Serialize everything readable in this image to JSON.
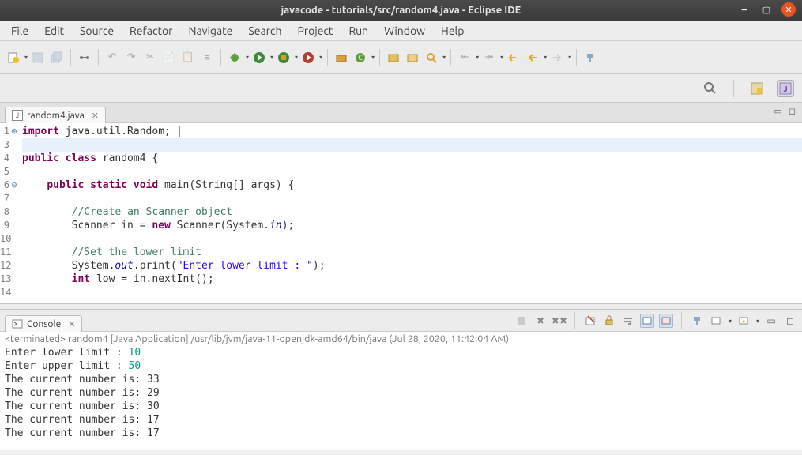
{
  "window": {
    "title": "javacode - tutorials/src/random4.java - Eclipse IDE"
  },
  "menubar": [
    "File",
    "Edit",
    "Source",
    "Refactor",
    "Navigate",
    "Search",
    "Project",
    "Run",
    "Window",
    "Help"
  ],
  "editor_tab": {
    "label": "random4.java"
  },
  "code": {
    "lines": [
      {
        "n": "1",
        "marker": "⊕",
        "tokens": [
          {
            "t": "import",
            "c": "kw"
          },
          {
            "t": " java.util.Random;"
          },
          {
            "t": " ",
            "c": "box"
          }
        ]
      },
      {
        "n": "3",
        "marker": "",
        "tokens": []
      },
      {
        "n": "4",
        "marker": "",
        "tokens": [
          {
            "t": "public class",
            "c": "kw"
          },
          {
            "t": " random4 {"
          }
        ]
      },
      {
        "n": "5",
        "marker": "",
        "tokens": []
      },
      {
        "n": "6",
        "marker": "⊖",
        "tokens": [
          {
            "t": "    "
          },
          {
            "t": "public static void",
            "c": "kw"
          },
          {
            "t": " main(String[] args) {"
          }
        ]
      },
      {
        "n": "7",
        "marker": "",
        "tokens": []
      },
      {
        "n": "8",
        "marker": "",
        "tokens": [
          {
            "t": "        "
          },
          {
            "t": "//Create an Scanner object",
            "c": "cm"
          }
        ]
      },
      {
        "n": "9",
        "marker": "",
        "tokens": [
          {
            "t": "        Scanner in = "
          },
          {
            "t": "new",
            "c": "kw"
          },
          {
            "t": " Scanner(System."
          },
          {
            "t": "in",
            "c": "fld"
          },
          {
            "t": ");"
          }
        ]
      },
      {
        "n": "10",
        "marker": "",
        "tokens": []
      },
      {
        "n": "11",
        "marker": "",
        "tokens": [
          {
            "t": "        "
          },
          {
            "t": "//Set the lower limit",
            "c": "cm"
          }
        ]
      },
      {
        "n": "12",
        "marker": "",
        "tokens": [
          {
            "t": "        System."
          },
          {
            "t": "out",
            "c": "fld"
          },
          {
            "t": ".print("
          },
          {
            "t": "\"Enter lower limit : \"",
            "c": "str"
          },
          {
            "t": ");"
          }
        ]
      },
      {
        "n": "13",
        "marker": "",
        "tokens": [
          {
            "t": "        "
          },
          {
            "t": "int",
            "c": "kw"
          },
          {
            "t": " low = in.nextInt();"
          }
        ]
      },
      {
        "n": "14",
        "marker": "",
        "tokens": []
      }
    ]
  },
  "console_tab": {
    "label": "Console"
  },
  "console": {
    "status": "<terminated> random4 [Java Application] /usr/lib/jvm/java-11-openjdk-amd64/bin/java (Jul 28, 2020, 11:42:04 AM)",
    "lines": [
      {
        "pre": "Enter lower limit : ",
        "val": "10"
      },
      {
        "pre": "Enter upper limit : ",
        "val": "50"
      },
      {
        "pre": "The current number is: 33",
        "val": ""
      },
      {
        "pre": "The current number is: 29",
        "val": ""
      },
      {
        "pre": "The current number is: 30",
        "val": ""
      },
      {
        "pre": "The current number is: 17",
        "val": ""
      },
      {
        "pre": "The current number is: 17",
        "val": ""
      }
    ]
  }
}
